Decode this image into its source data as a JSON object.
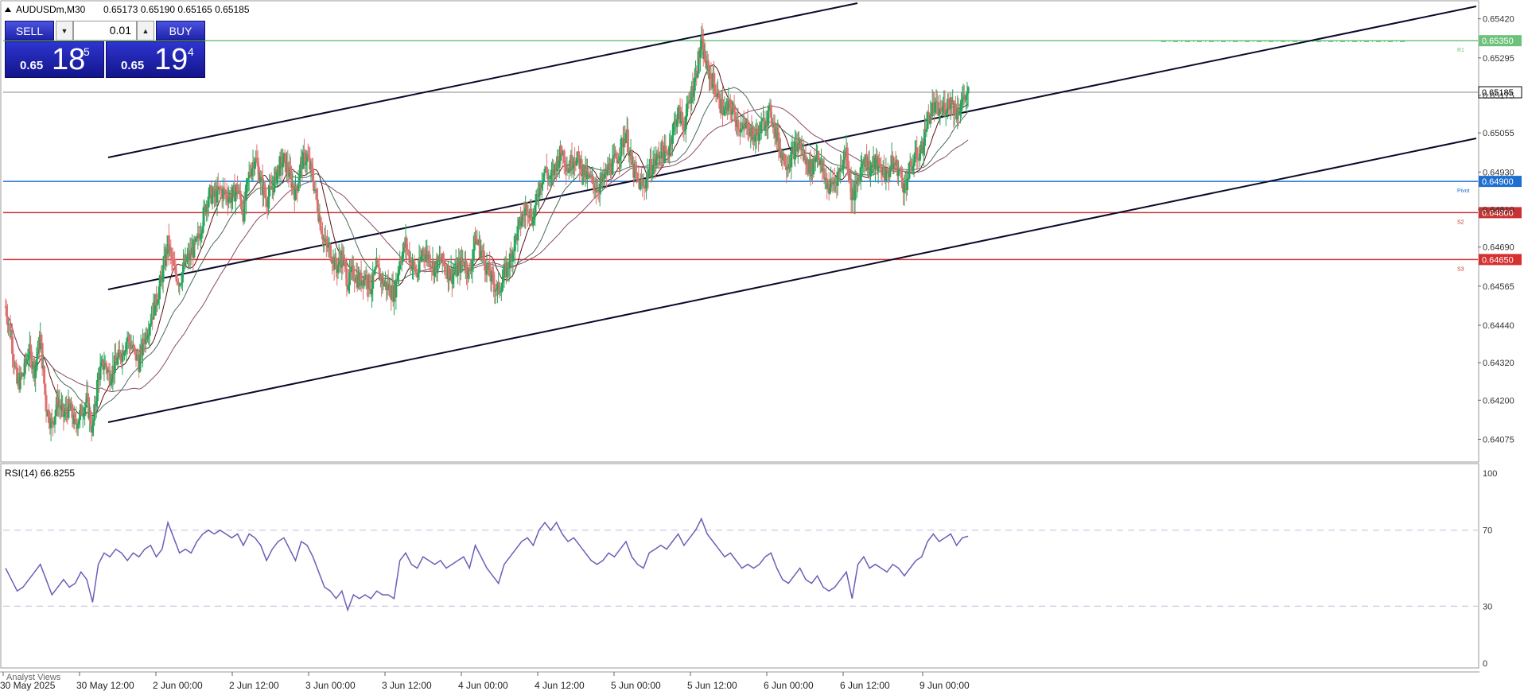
{
  "header": {
    "symbol_timeframe": "AUDUSDm,M30",
    "ohlc": "0.65173 0.65190 0.65165 0.65185"
  },
  "trade_panel": {
    "sell_label": "SELL",
    "buy_label": "BUY",
    "volume": "0.01",
    "sell_prefix": "0.65",
    "sell_big": "18",
    "sell_sup": "5",
    "buy_prefix": "0.65",
    "buy_big": "19",
    "buy_sup": "4",
    "button_color": "#2a30c8"
  },
  "rsi_header": "RSI(14) 66.8255",
  "bottom_tab": "Analyst Views",
  "chart_data": [
    {
      "type": "candlestick",
      "symbol": "AUDUSDm",
      "timeframe": "M30",
      "ylim": [
        0.6401,
        0.6547
      ],
      "y_ticks": [
        "0.65420",
        "0.65295",
        "0.65175",
        "0.65055",
        "0.64930",
        "0.64810",
        "0.64690",
        "0.64565",
        "0.64440",
        "0.64320",
        "0.64200",
        "0.64075"
      ],
      "x_ticks": [
        "30 May 2025",
        "30 May 12:00",
        "2 Jun 00:00",
        "2 Jun 12:00",
        "3 Jun 00:00",
        "3 Jun 12:00",
        "4 Jun 00:00",
        "4 Jun 12:00",
        "5 Jun 00:00",
        "5 Jun 12:00",
        "6 Jun 00:00",
        "6 Jun 12:00",
        "9 Jun 00:00"
      ],
      "current_price": "0.65185",
      "up_color": "#26a65b",
      "down_color": "#e07070",
      "levels": [
        {
          "name": "R1",
          "value": "0.65350",
          "color": "#6cc27a"
        },
        {
          "name": "Pivot",
          "value": "0.64900",
          "color": "#1e6fd0"
        },
        {
          "name": "S2",
          "value": "0.64800",
          "color": "#c83232"
        },
        {
          "name": "S3",
          "value": "0.64650",
          "color": "#d63030"
        }
      ],
      "close_path": [
        [
          0,
          0.645
        ],
        [
          6,
          0.644
        ],
        [
          12,
          0.6425
        ],
        [
          18,
          0.6428
        ],
        [
          24,
          0.6436
        ],
        [
          30,
          0.643
        ],
        [
          36,
          0.644
        ],
        [
          42,
          0.6418
        ],
        [
          48,
          0.6412
        ],
        [
          54,
          0.642
        ],
        [
          60,
          0.6415
        ],
        [
          66,
          0.6418
        ],
        [
          72,
          0.6412
        ],
        [
          78,
          0.6416
        ],
        [
          84,
          0.642
        ],
        [
          90,
          0.641
        ],
        [
          96,
          0.6428
        ],
        [
          102,
          0.6432
        ],
        [
          108,
          0.6428
        ],
        [
          114,
          0.6432
        ],
        [
          120,
          0.6435
        ],
        [
          126,
          0.644
        ],
        [
          132,
          0.6436
        ],
        [
          138,
          0.6432
        ],
        [
          144,
          0.644
        ],
        [
          150,
          0.6446
        ],
        [
          156,
          0.6452
        ],
        [
          162,
          0.646
        ],
        [
          168,
          0.647
        ],
        [
          174,
          0.6462
        ],
        [
          180,
          0.6458
        ],
        [
          186,
          0.6464
        ],
        [
          192,
          0.6467
        ],
        [
          198,
          0.647
        ],
        [
          204,
          0.6478
        ],
        [
          210,
          0.6486
        ],
        [
          216,
          0.6485
        ],
        [
          222,
          0.6487
        ],
        [
          228,
          0.6486
        ],
        [
          234,
          0.6485
        ],
        [
          240,
          0.6488
        ],
        [
          246,
          0.648
        ],
        [
          252,
          0.6492
        ],
        [
          258,
          0.6498
        ],
        [
          264,
          0.649
        ],
        [
          270,
          0.6484
        ],
        [
          276,
          0.6488
        ],
        [
          282,
          0.6494
        ],
        [
          288,
          0.6497
        ],
        [
          294,
          0.6492
        ],
        [
          300,
          0.6486
        ],
        [
          306,
          0.6496
        ],
        [
          312,
          0.6498
        ],
        [
          318,
          0.6491
        ],
        [
          324,
          0.648
        ],
        [
          330,
          0.647
        ],
        [
          336,
          0.6468
        ],
        [
          342,
          0.6462
        ],
        [
          348,
          0.6466
        ],
        [
          354,
          0.6458
        ],
        [
          360,
          0.6461
        ],
        [
          366,
          0.6458
        ],
        [
          372,
          0.646
        ],
        [
          378,
          0.6456
        ],
        [
          384,
          0.6462
        ],
        [
          390,
          0.6458
        ],
        [
          396,
          0.6456
        ],
        [
          402,
          0.6454
        ],
        [
          408,
          0.6465
        ],
        [
          414,
          0.647
        ],
        [
          420,
          0.6464
        ],
        [
          426,
          0.646
        ],
        [
          432,
          0.6468
        ],
        [
          438,
          0.6466
        ],
        [
          444,
          0.6462
        ],
        [
          450,
          0.6465
        ],
        [
          456,
          0.6462
        ],
        [
          462,
          0.646
        ],
        [
          468,
          0.6462
        ],
        [
          474,
          0.6465
        ],
        [
          480,
          0.646
        ],
        [
          486,
          0.6472
        ],
        [
          492,
          0.6468
        ],
        [
          498,
          0.6462
        ],
        [
          504,
          0.6458
        ],
        [
          510,
          0.6455
        ],
        [
          516,
          0.646
        ],
        [
          522,
          0.6465
        ],
        [
          528,
          0.6472
        ],
        [
          534,
          0.6478
        ],
        [
          540,
          0.6482
        ],
        [
          546,
          0.6478
        ],
        [
          552,
          0.6488
        ],
        [
          558,
          0.6494
        ],
        [
          564,
          0.649
        ],
        [
          570,
          0.6496
        ],
        [
          576,
          0.65
        ],
        [
          582,
          0.6494
        ],
        [
          588,
          0.6498
        ],
        [
          594,
          0.6496
        ],
        [
          600,
          0.6492
        ],
        [
          606,
          0.649
        ],
        [
          612,
          0.6488
        ],
        [
          618,
          0.649
        ],
        [
          624,
          0.6494
        ],
        [
          630,
          0.6496
        ],
        [
          636,
          0.65
        ],
        [
          642,
          0.6506
        ],
        [
          648,
          0.6495
        ],
        [
          654,
          0.649
        ],
        [
          660,
          0.6488
        ],
        [
          666,
          0.6494
        ],
        [
          672,
          0.6496
        ],
        [
          678,
          0.65
        ],
        [
          684,
          0.6498
        ],
        [
          690,
          0.6506
        ],
        [
          696,
          0.6512
        ],
        [
          702,
          0.6508
        ],
        [
          708,
          0.6516
        ],
        [
          714,
          0.6524
        ],
        [
          720,
          0.6534
        ],
        [
          726,
          0.6526
        ],
        [
          732,
          0.6522
        ],
        [
          738,
          0.6516
        ],
        [
          744,
          0.6512
        ],
        [
          750,
          0.6514
        ],
        [
          756,
          0.651
        ],
        [
          762,
          0.6506
        ],
        [
          768,
          0.6508
        ],
        [
          774,
          0.6504
        ],
        [
          780,
          0.6506
        ],
        [
          786,
          0.651
        ],
        [
          792,
          0.6512
        ],
        [
          798,
          0.6504
        ],
        [
          804,
          0.6498
        ],
        [
          810,
          0.6496
        ],
        [
          816,
          0.65
        ],
        [
          822,
          0.6502
        ],
        [
          828,
          0.6496
        ],
        [
          834,
          0.6494
        ],
        [
          840,
          0.65
        ],
        [
          846,
          0.6492
        ],
        [
          852,
          0.6488
        ],
        [
          858,
          0.649
        ],
        [
          864,
          0.6494
        ],
        [
          870,
          0.65
        ],
        [
          876,
          0.6484
        ],
        [
          882,
          0.649
        ],
        [
          888,
          0.6498
        ],
        [
          894,
          0.6494
        ],
        [
          900,
          0.6496
        ],
        [
          906,
          0.6494
        ],
        [
          912,
          0.6492
        ],
        [
          918,
          0.6496
        ],
        [
          924,
          0.6494
        ],
        [
          930,
          0.6488
        ],
        [
          936,
          0.6494
        ],
        [
          942,
          0.6498
        ],
        [
          948,
          0.65
        ],
        [
          954,
          0.651
        ],
        [
          960,
          0.6514
        ],
        [
          966,
          0.6512
        ],
        [
          972,
          0.6514
        ],
        [
          978,
          0.6516
        ],
        [
          984,
          0.6512
        ],
        [
          990,
          0.6516
        ],
        [
          996,
          0.6518
        ]
      ]
    },
    {
      "type": "line",
      "title": "RSI(14) 66.8255",
      "ylim": [
        0,
        100
      ],
      "y_ticks": [
        "100",
        "70",
        "30",
        "0"
      ],
      "levels": [
        70,
        30
      ],
      "color": "#6b5fb8",
      "series": [
        [
          0,
          50
        ],
        [
          6,
          44
        ],
        [
          12,
          38
        ],
        [
          18,
          40
        ],
        [
          24,
          44
        ],
        [
          30,
          48
        ],
        [
          36,
          52
        ],
        [
          42,
          44
        ],
        [
          48,
          36
        ],
        [
          54,
          40
        ],
        [
          60,
          44
        ],
        [
          66,
          40
        ],
        [
          72,
          42
        ],
        [
          78,
          48
        ],
        [
          84,
          44
        ],
        [
          90,
          32
        ],
        [
          96,
          52
        ],
        [
          102,
          58
        ],
        [
          108,
          56
        ],
        [
          114,
          60
        ],
        [
          120,
          58
        ],
        [
          126,
          54
        ],
        [
          132,
          58
        ],
        [
          138,
          56
        ],
        [
          144,
          60
        ],
        [
          150,
          62
        ],
        [
          156,
          56
        ],
        [
          162,
          60
        ],
        [
          168,
          74
        ],
        [
          174,
          66
        ],
        [
          180,
          58
        ],
        [
          186,
          60
        ],
        [
          192,
          58
        ],
        [
          198,
          64
        ],
        [
          204,
          68
        ],
        [
          210,
          70
        ],
        [
          216,
          68
        ],
        [
          222,
          70
        ],
        [
          228,
          68
        ],
        [
          234,
          66
        ],
        [
          240,
          68
        ],
        [
          246,
          62
        ],
        [
          252,
          68
        ],
        [
          258,
          66
        ],
        [
          264,
          62
        ],
        [
          270,
          54
        ],
        [
          276,
          60
        ],
        [
          282,
          64
        ],
        [
          288,
          66
        ],
        [
          294,
          60
        ],
        [
          300,
          54
        ],
        [
          306,
          64
        ],
        [
          312,
          62
        ],
        [
          318,
          56
        ],
        [
          324,
          48
        ],
        [
          330,
          40
        ],
        [
          336,
          38
        ],
        [
          342,
          34
        ],
        [
          348,
          38
        ],
        [
          354,
          28
        ],
        [
          360,
          36
        ],
        [
          366,
          34
        ],
        [
          372,
          36
        ],
        [
          378,
          34
        ],
        [
          384,
          38
        ],
        [
          390,
          36
        ],
        [
          396,
          36
        ],
        [
          402,
          34
        ],
        [
          408,
          54
        ],
        [
          414,
          58
        ],
        [
          420,
          52
        ],
        [
          426,
          50
        ],
        [
          432,
          56
        ],
        [
          438,
          54
        ],
        [
          444,
          52
        ],
        [
          450,
          54
        ],
        [
          456,
          50
        ],
        [
          462,
          52
        ],
        [
          468,
          54
        ],
        [
          474,
          56
        ],
        [
          480,
          50
        ],
        [
          486,
          62
        ],
        [
          492,
          56
        ],
        [
          498,
          50
        ],
        [
          504,
          46
        ],
        [
          510,
          42
        ],
        [
          516,
          52
        ],
        [
          522,
          56
        ],
        [
          528,
          60
        ],
        [
          534,
          64
        ],
        [
          540,
          66
        ],
        [
          546,
          62
        ],
        [
          552,
          70
        ],
        [
          558,
          74
        ],
        [
          564,
          70
        ],
        [
          570,
          74
        ],
        [
          576,
          68
        ],
        [
          582,
          64
        ],
        [
          588,
          66
        ],
        [
          594,
          62
        ],
        [
          600,
          58
        ],
        [
          606,
          54
        ],
        [
          612,
          52
        ],
        [
          618,
          54
        ],
        [
          624,
          58
        ],
        [
          630,
          56
        ],
        [
          636,
          60
        ],
        [
          642,
          64
        ],
        [
          648,
          56
        ],
        [
          654,
          52
        ],
        [
          660,
          50
        ],
        [
          666,
          58
        ],
        [
          672,
          60
        ],
        [
          678,
          62
        ],
        [
          684,
          60
        ],
        [
          690,
          64
        ],
        [
          696,
          68
        ],
        [
          702,
          62
        ],
        [
          708,
          66
        ],
        [
          714,
          70
        ],
        [
          720,
          76
        ],
        [
          726,
          68
        ],
        [
          732,
          64
        ],
        [
          738,
          60
        ],
        [
          744,
          56
        ],
        [
          750,
          58
        ],
        [
          756,
          54
        ],
        [
          762,
          50
        ],
        [
          768,
          52
        ],
        [
          774,
          50
        ],
        [
          780,
          52
        ],
        [
          786,
          56
        ],
        [
          792,
          58
        ],
        [
          798,
          50
        ],
        [
          804,
          44
        ],
        [
          810,
          42
        ],
        [
          816,
          46
        ],
        [
          822,
          50
        ],
        [
          828,
          44
        ],
        [
          834,
          42
        ],
        [
          840,
          46
        ],
        [
          846,
          40
        ],
        [
          852,
          38
        ],
        [
          858,
          40
        ],
        [
          864,
          44
        ],
        [
          870,
          48
        ],
        [
          876,
          34
        ],
        [
          882,
          52
        ],
        [
          888,
          56
        ],
        [
          894,
          50
        ],
        [
          900,
          52
        ],
        [
          906,
          50
        ],
        [
          912,
          48
        ],
        [
          918,
          52
        ],
        [
          924,
          50
        ],
        [
          930,
          46
        ],
        [
          936,
          50
        ],
        [
          942,
          54
        ],
        [
          948,
          56
        ],
        [
          954,
          64
        ],
        [
          960,
          68
        ],
        [
          966,
          64
        ],
        [
          972,
          66
        ],
        [
          978,
          68
        ],
        [
          984,
          62
        ],
        [
          990,
          66
        ],
        [
          996,
          66.8
        ]
      ]
    }
  ]
}
